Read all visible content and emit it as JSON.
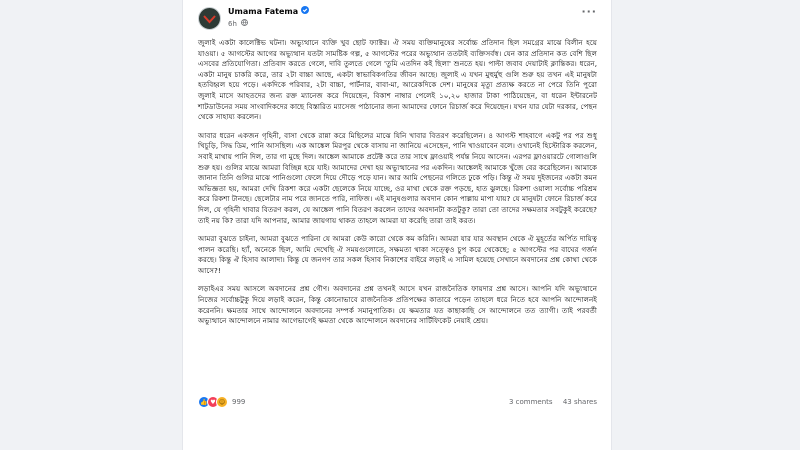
{
  "author": {
    "name": "Umama Fatema",
    "time": "6h",
    "verified_icon": "verified-badge-icon",
    "privacy_icon": "globe-icon"
  },
  "more_label": "···",
  "post": {
    "paragraphs": [
      "জুলাই একটা কালেক্টিভ ঘটনা। অভ্যুত্থানে ব্যক্তি খুব ছোট ফ্যাক্টর। ঐ সময় ব্যক্তিমানুষের সর্বোচ্চ প্রতিদান ছিল সমগ্রের মাঝে বিলীন হয়ে যাওয়া। ৫ আগস্টের আগের অভ্যুত্থান যতটা সামষ্টিক গল্প, ৫ আগস্টের পরের অভ্যুত্থান ততটাই ব্যক্তিসর্বস্ব। যেন কার প্রতিদান কত বেশি ছিল এসবের প্রতিযোগিতা। প্রতিবাদ করতে গেলে, দাবি তুলতে গেলে 'তুমি এতদিন কই ছিলা' শুনতে হয়। পাল্টা জবাব দেয়াটাই ক্লান্তিকর। ধরেন, একটা মানুষ চাকরি করে, তার ২টা বাচ্চা আছে, একটা স্বাভাবিকগতির জীবন আছে। জুলাই এ যখন মুহুর্মুহু গুলি শুরু হয় তখন এই মানুষটা হতবিহ্বল হয়ে পড়ে। একদিকে পরিবার, ২টা বাচ্চা, পার্টনার, বাবা-মা, আরেকদিকে দেশ। মানুষের মৃত্যু প্রত্যক্ষ করতে না পেরে তিনি পুরো জুলাই মাসে আহতদের জন্য রক্ত ম্যানেজ করে দিয়েছেন, বিকাশ নাম্বার পেলেই ১০,২০ হাজার টাকা পাঠিয়েছেন, বা ধরেন ইন্টারনেট শাটডাউনের সময় সাংবাদিকদের কাছে বিস্তারিত ম্যাসেজ পাঠানোর জন্য আমাদের ফোনে রিচার্জ করে দিয়েছেন। যখন যার যেটা দরকার, পেছন থেকে সাহায্য করলেন।",
      "আবার ধরেন একজন গৃহিনী, বাসা থেকে রান্না করে মিছিলের মাঝে যিনি খাবার বিতরণ করেছিলেন। ৪ আগস্ট শাহবাগে একটু পর পর শুধু খিচুড়ি, সিদ্ধ ডিম, পানি আসছিল। এক আঙ্কেল মিরপুর থেকে বাসায় না জানিয়ে এসেছেন, পানি খাওয়াবেন বলে। ওখানেই হিস্টোরিক করলেন, সবাই মাথায় পানি দিল, তার গা মুছে দিল। আঙ্কেল আমাকে প্রটেক্ট করে তার সাথে ফ্লাওয়াই পর্যন্ত নিয়ে আসেন। এরপর ফ্লাওয়ারটে গোলাগুলি শুরু হয়। গুলির মাঝে আমরা বিচ্ছিন্ন হয়ে যাই। আমাদের দেখা হয় অভ্যুত্থানের পর একদিন। আঙ্কেলই আমাকে খুঁজে বের করেছিলেন। আমাকে জানান তিনি গুলির মাঝে পানিগুলো ফেলে দিয়ে দৌড়ে পড়ে যান। আর আমি পেছনের গলিতে ঢুকে পড়ি। কিন্তু ঐ সময় দুইজনের একটা কমন অভিজ্ঞতা হয়, আমরা দেখি রিকশা করে একটা ছেলেকে নিয়ে যাচ্ছে, ওর মাথা থেকে রক্ত পড়ছে, হাত ঝুলছে। রিকশা ওয়ালা সর্বোচ্চ পরিশ্রম করে রিকশা টানছে। ছেলেটার নাম পরে জানতে পারি, নাফিজ। এই মানুষগুলার অবদান কোন পাল্লায় মাপা যায়? যে মানুষটা ফোনে রিচার্জ করে দিল, যে গৃহিনী খাবার বিতরণ করল, যে আঙ্কেল পানি বিতরণ করলেন তাদের অবদানটা কতটুকু? তারা তো তাদের সক্ষমতার সবটুকুই করেছে? তাই নয় কি? তারা যদি আপনার, আমার জায়গায় থাকত তাহলে আমরা যা করেছি তারা তাই করত।",
      "আমরা বুঝতে চাইনা, আমরা বুঝতে পারিনা যে আমরা কেউ কারো থেকে কম করিনি। আমরা যার যার অবস্থান থেকে ঐ মুহূর্তের অর্পিত দায়িত্ব পালন করেছি। হ্যাঁ, অনেকে ছিল, আমি দেখেছি ঐ সময়গুলোতে, সক্ষমতা থাকা সত্ত্বেও চুপ করে থেকেছে; ৫ আগস্টের পর বাঘের গর্জন করছে। কিন্তু ঐ হিসাব আলাদা। কিন্তু যে জনগণ তার সকল হিসাব নিকাশের বাইরে লড়াই এ সামিল হয়েছে সেখানে অবদানের প্রশ্ন কোথা থেকে আসে?!",
      "লড়াইএর সময় আসলে অবদানের প্রশ্ন গৌণ। অবদানের প্রশ্ন তখনই আসে যখন রাজনৈতিক ফায়দার প্রশ্ন আসে। আপনি যদি অভ্যুত্থানে নিজের সর্বোচ্চটুকু দিয়ে লড়াই করেন, কিন্তু কোনোভাবে রাজনৈতিক প্রতিপক্ষের কাতারে পড়েন তাহলে ধরে নিতে হবে আপনি আন্দোলনই করেননি। ক্ষমতার সাথে আন্দোলনে অবদানের সম্পর্ক সমানুপাতিক। যে ক্ষমতার যত কাছাকাছি সে আন্দোলনে তত ত্যাগী। তাই পরবর্তী অভ্যুত্থানে আন্দোলনে নামার আগেভাগেই ক্ষমতা থেকে আন্দোলনে অবদানের সার্টিফিকেট নেয়াই শ্রেয়।"
    ]
  },
  "footer": {
    "reaction_count": "999",
    "comments": "3 comments",
    "shares": "43 shares",
    "reaction_icons": [
      "like-icon",
      "love-icon",
      "care-icon"
    ]
  }
}
